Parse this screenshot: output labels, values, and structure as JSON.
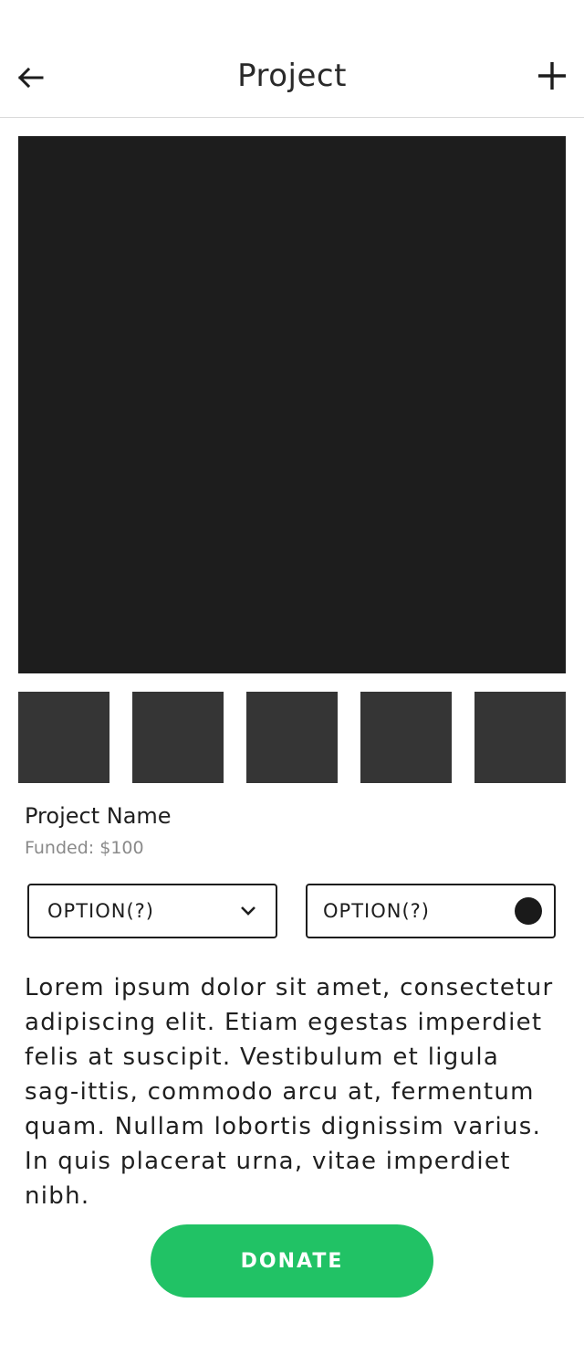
{
  "header": {
    "title": "Project",
    "back_icon": "arrow-left-icon",
    "add_icon": "plus-icon"
  },
  "gallery": {
    "hero_color": "#1d1d1d",
    "thumbnail_color": "#353535"
  },
  "project": {
    "name": "Project Name",
    "funded": "Funded: $100"
  },
  "options": {
    "dropdown_label": "OPTION(?)",
    "toggle_label": "OPTION(?)"
  },
  "description": "Lorem ipsum dolor sit amet, consectetur adipiscing elit. Etiam egestas imperdiet felis at suscipit. Vestibulum et ligula sag-ittis, commodo arcu at, fermentum quam. Nullam lobortis dignissim varius. In quis placerat urna, vitae imperdiet nibh.",
  "donate": {
    "label": "DONATE",
    "color": "#21c265"
  }
}
